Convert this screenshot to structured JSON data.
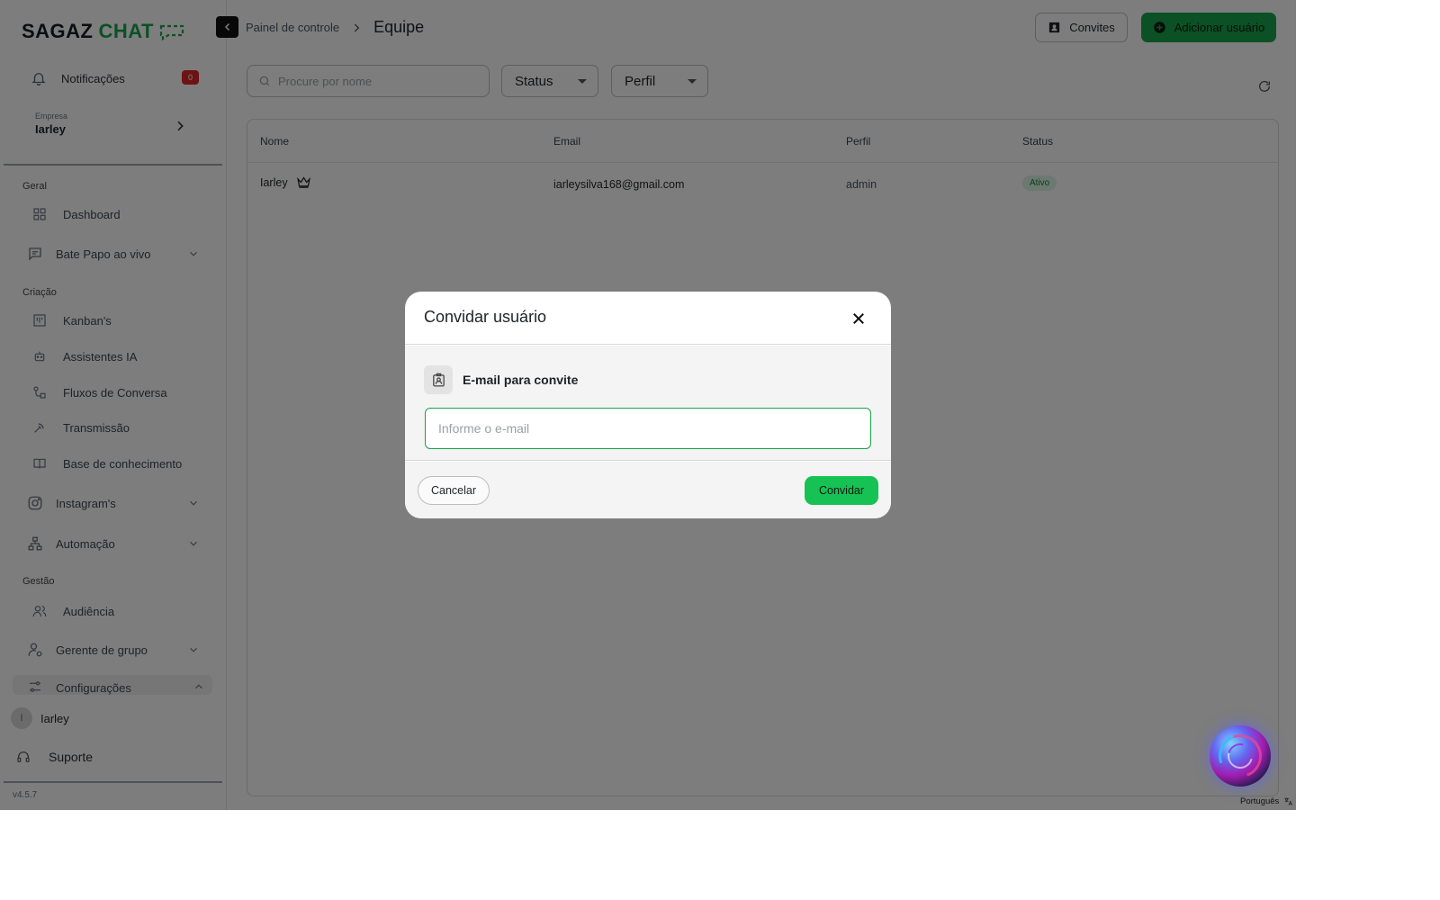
{
  "app": {
    "logo_part1": "SAGAZ",
    "logo_part2": "CHAT",
    "version": "v4.5.7",
    "language": "Português"
  },
  "sidebar": {
    "notifications_label": "Notificações",
    "notifications_count": "0",
    "company_label": "Empresa",
    "company_name": "Iarley",
    "sections": {
      "geral": "Geral",
      "criacao": "Criação",
      "gestao": "Gestão"
    },
    "items": {
      "dashboard": "Dashboard",
      "bate_papo": "Bate Papo ao vivo",
      "kanbans": "Kanban's",
      "assistentes": "Assistentes IA",
      "fluxos": "Fluxos de Conversa",
      "transmissao": "Transmissão",
      "base": "Base de conhecimento",
      "instagram": "Instagram's",
      "automacao": "Automação",
      "audiencia": "Audiência",
      "gerente_grupo": "Gerente de grupo",
      "configuracoes": "Configurações"
    },
    "user_initial": "I",
    "user_name": "Iarley",
    "support_label": "Suporte"
  },
  "header": {
    "breadcrumb_parent": "Painel de controle",
    "breadcrumb_current": "Equipe",
    "invites_button": "Convites",
    "add_user_button": "Adicionar usuário"
  },
  "filters": {
    "search_placeholder": "Procure por nome",
    "status_select": "Status",
    "profile_select": "Perfil"
  },
  "table": {
    "columns": [
      "Nome",
      "Email",
      "Perfil",
      "Status"
    ],
    "rows": [
      {
        "name": "Iarley",
        "email": "iarleysilva168@gmail.com",
        "profile": "admin",
        "status": "Ativo"
      }
    ]
  },
  "modal": {
    "title": "Convidar usuário",
    "field_label": "E-mail para convite",
    "email_placeholder": "Informe o e-mail",
    "email_value": "",
    "cancel_button": "Cancelar",
    "invite_button": "Convidar"
  },
  "colors": {
    "brand_green": "#16a34a",
    "badge_red": "#dc2626",
    "overlay": "rgba(0,0,0,0.5)"
  }
}
